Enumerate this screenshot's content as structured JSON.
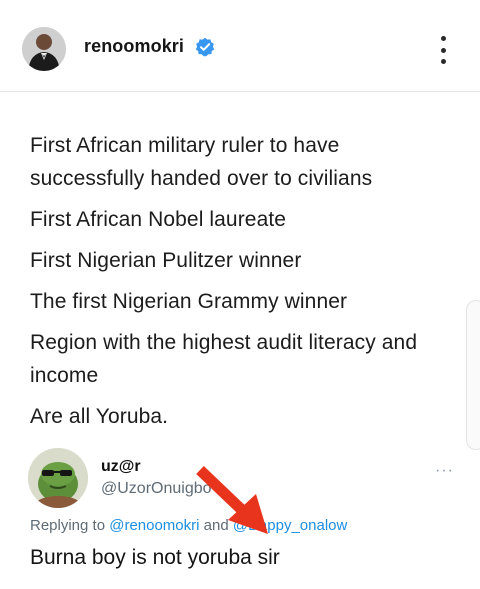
{
  "header": {
    "username": "renoomokri",
    "verified_icon": "verified-badge-icon",
    "more_icon": "kebab-menu-icon",
    "accent": "#3897f0"
  },
  "post": {
    "lines": [
      "First African military ruler to have successfully handed over to civilians",
      "First African Nobel laureate",
      "First Nigerian Pulitzer winner",
      "The first Nigerian Grammy winner",
      "Region with the highest audit literacy and income",
      "Are all Yoruba."
    ]
  },
  "reply": {
    "display_name": "uz@r",
    "handle": "@UzorOnuigbo",
    "more_dots": "···",
    "replying_to_label": "Replying to",
    "mention_1": "@renoomokri",
    "and_label": "and",
    "mention_2": "@Dappy_onalow",
    "text": "Burna boy is not yoruba sir",
    "mention_color": "#1d8fe0",
    "arrow_color": "#e8341c"
  }
}
